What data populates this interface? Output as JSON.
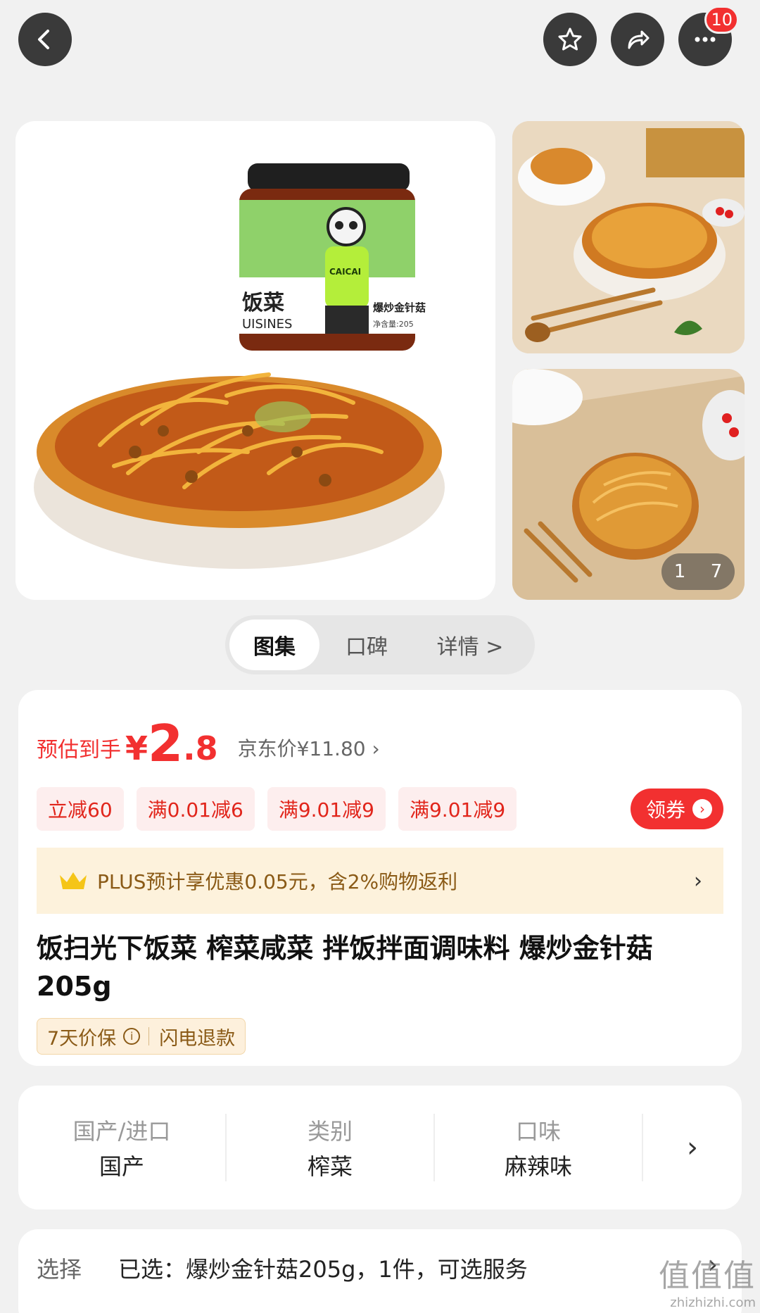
{
  "header": {
    "notification_count": "10"
  },
  "gallery": {
    "current_index": "1",
    "total": "7",
    "jar_label_top": "饭菜",
    "jar_label_en": "UISINES",
    "jar_label_brand": "CAICAI",
    "jar_label_side": "爆炒金针菇",
    "jar_label_weight": "净含量:205"
  },
  "tabs": [
    {
      "label": "图集"
    },
    {
      "label": "口碑"
    },
    {
      "label": "详情 >"
    }
  ],
  "price": {
    "estimate_label": "预估到手",
    "currency": "¥",
    "integer": "2",
    "decimal": ".8",
    "jd_price": "京东价¥11.80 ›"
  },
  "coupons": [
    "立减60",
    "满0.01减6",
    "满9.01减9",
    "满9.01减9"
  ],
  "get_coupon_label": "领券",
  "plus_bar": {
    "text": "PLUS预计享优惠0.05元，含2%购物返利",
    "arrow": "›"
  },
  "product": {
    "title": "饭扫光下饭菜 榨菜咸菜 拌饭拌面调味料 爆炒金针菇 205g"
  },
  "guarantee": {
    "price_protect": "7天价保",
    "refund": "闪电退款"
  },
  "specs": [
    {
      "label": "国产/进口",
      "value": "国产"
    },
    {
      "label": "类别",
      "value": "榨菜"
    },
    {
      "label": "口味",
      "value": "麻辣味"
    }
  ],
  "selection": {
    "label": "选择",
    "value": "已选：爆炒金针菇205g，1件，可选服务"
  },
  "watermark": {
    "big": "值值值",
    "small": "zhizhizhi.com"
  },
  "colors": {
    "accent_red": "#f23030",
    "plus_gold": "#8a5a16"
  }
}
